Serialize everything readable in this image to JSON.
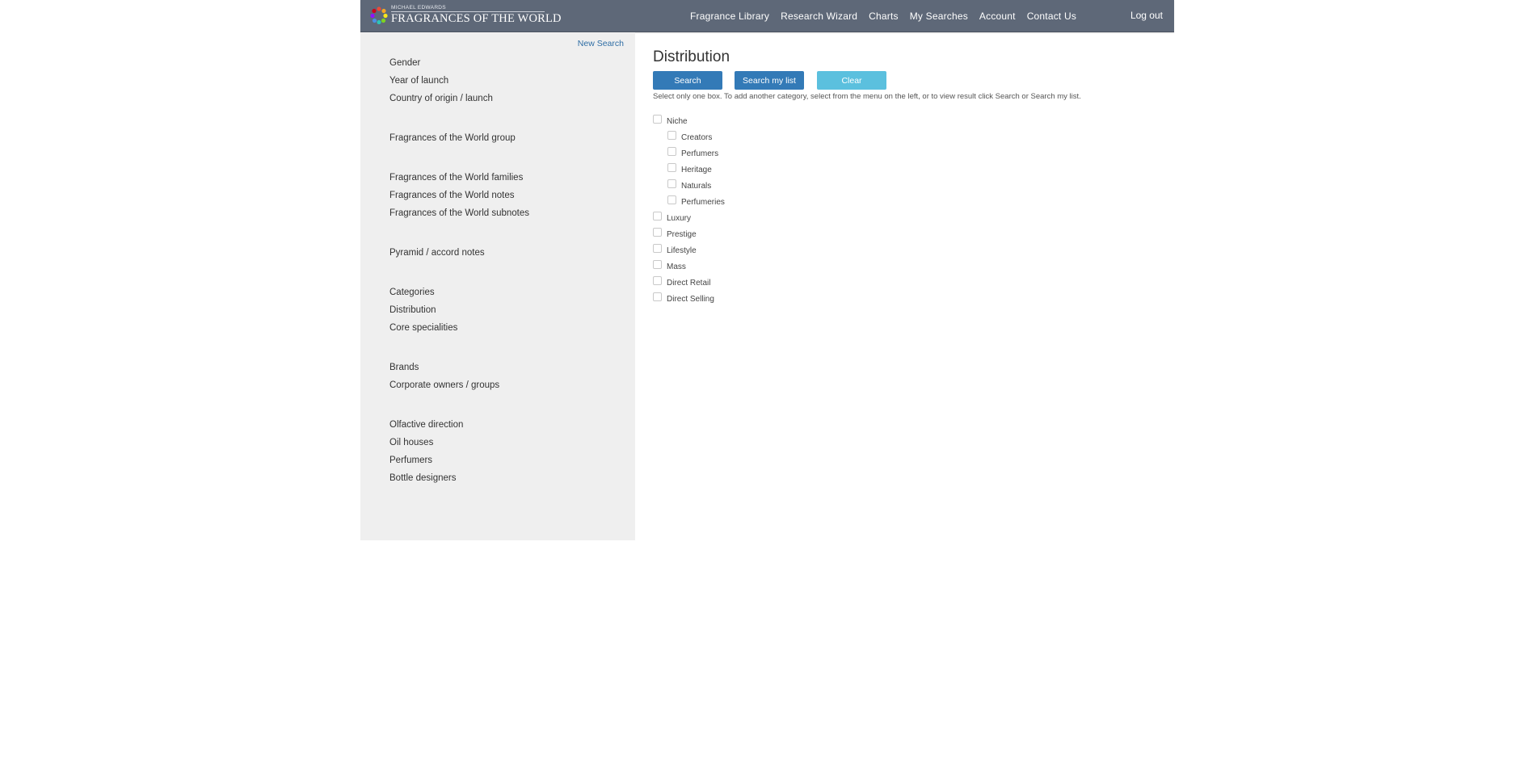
{
  "header": {
    "logo_small": "MICHAEL EDWARDS",
    "logo_main": "FRAGRANCES OF THE WORLD",
    "nav": [
      {
        "label": "Fragrance Library"
      },
      {
        "label": "Research Wizard"
      },
      {
        "label": "Charts"
      },
      {
        "label": "My Searches"
      },
      {
        "label": "Account"
      },
      {
        "label": "Contact Us"
      }
    ],
    "logout": "Log out"
  },
  "sidebar": {
    "new_search": "New Search",
    "groups": [
      [
        "Gender",
        "Year of launch",
        "Country of origin / launch"
      ],
      [
        "Fragrances of the World group"
      ],
      [
        "Fragrances of the World families",
        "Fragrances of the World notes",
        "Fragrances of the World subnotes"
      ],
      [
        "Pyramid / accord notes"
      ],
      [
        "Categories",
        "Distribution",
        "Core specialities"
      ],
      [
        "Brands",
        "Corporate owners / groups"
      ],
      [
        "Olfactive direction",
        "Oil houses",
        "Perfumers",
        "Bottle designers"
      ]
    ]
  },
  "main": {
    "title": "Distribution",
    "buttons": {
      "search": "Search",
      "search_my_list": "Search my list",
      "clear": "Clear"
    },
    "hint": "Select only one box. To add another category, select from the menu on the left, or to view result click Search or Search my list.",
    "options": [
      {
        "label": "Niche",
        "level": 0
      },
      {
        "label": "Creators",
        "level": 1
      },
      {
        "label": "Perfumers",
        "level": 1
      },
      {
        "label": "Heritage",
        "level": 1
      },
      {
        "label": "Naturals",
        "level": 1
      },
      {
        "label": "Perfumeries",
        "level": 1
      },
      {
        "label": "Luxury",
        "level": 0
      },
      {
        "label": "Prestige",
        "level": 0
      },
      {
        "label": "Lifestyle",
        "level": 0
      },
      {
        "label": "Mass",
        "level": 0
      },
      {
        "label": "Direct Retail",
        "level": 0
      },
      {
        "label": "Direct Selling",
        "level": 0
      }
    ]
  },
  "colors": {
    "header_bg": "#5e6878",
    "primary": "#337ab7",
    "info": "#5bc0de",
    "sidebar_bg": "#efefef"
  }
}
